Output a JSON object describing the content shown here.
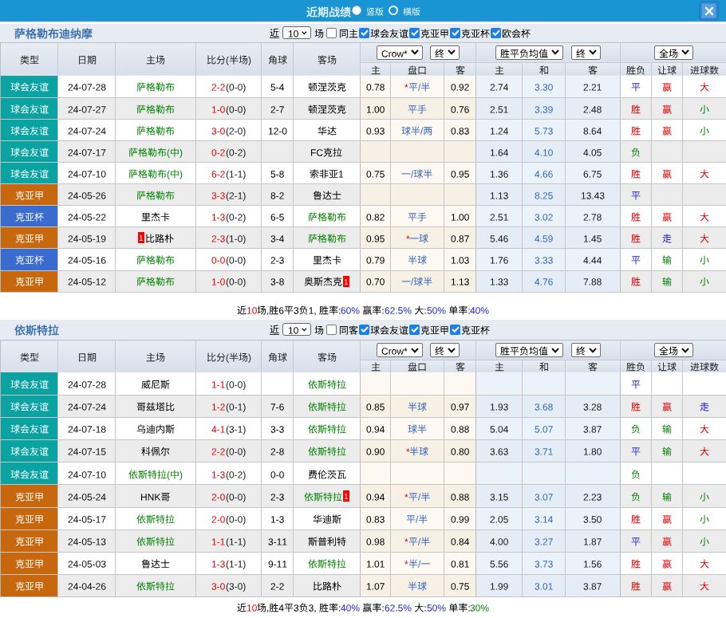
{
  "titlebar": {
    "title": "近期战绩",
    "radio_vertical_label": "竖版",
    "radio_horizontal_label": "横版",
    "radio_selected": "竖版",
    "close_icon": "x"
  },
  "icons": {
    "close": "x-mark",
    "select_chevron": "chevron-down",
    "checkbox_check": "check-mark"
  },
  "league_colors": {
    "球会友谊": "#0ba2a2",
    "克亚甲": "#c8680e",
    "克亚杯": "#3a6cd0"
  },
  "result_colors": {
    "胜": "#dd0000",
    "平": "#2222cc",
    "负": "#008000",
    "赢": "#dd0000",
    "走": "#2222cc",
    "输": "#008000",
    "大": "#dd0000",
    "小": "#008000"
  },
  "sections": [
    {
      "team": "萨格勒布迪纳摩",
      "filters": {
        "near_label": "近",
        "games_value": "10",
        "games_suffix": "场",
        "same_label": "同主",
        "same_checked": false,
        "leagues": [
          {
            "label": "球会友谊",
            "checked": true
          },
          {
            "label": "克亚甲",
            "checked": true
          },
          {
            "label": "克亚杯",
            "checked": true
          },
          {
            "label": "欧会杯",
            "checked": true
          }
        ]
      },
      "header": {
        "type": "类型",
        "date": "日期",
        "home": "主场",
        "score": "比分(半场)",
        "corner": "角球",
        "away": "客场",
        "odds_select": "Crow*",
        "odds_final_select": "终",
        "odds_home": "主",
        "handicap": "盘口",
        "odds_away": "客",
        "avg_select": "胜平负均值",
        "avg_final_select": "终",
        "avg_home": "主",
        "avg_draw": "和",
        "avg_away": "客",
        "scope_select": "全场",
        "result": "胜负",
        "handicap_result": "让球",
        "goals": "进球数"
      },
      "rows": [
        {
          "type": "球会友谊",
          "date": "24-07-28",
          "home": "萨格勒布",
          "home_hl": 1,
          "home_card": "",
          "away": "顿涅茨克",
          "away_hl": 0,
          "away_card": "",
          "ft": "2-2",
          "ht": "(0-0)",
          "corner": "5-4",
          "o1": "0.78",
          "star": "*",
          "hcap": "平/半",
          "o2": "0.92",
          "a1": "2.74",
          "a2": "3.30",
          "a3": "2.21",
          "res": "平",
          "hres": "赢",
          "goal": "大"
        },
        {
          "type": "球会友谊",
          "date": "24-07-27",
          "home": "萨格勒布",
          "home_hl": 1,
          "home_card": "",
          "away": "顿涅茨克",
          "away_hl": 0,
          "away_card": "",
          "ft": "1-0",
          "ht": "(0-0)",
          "corner": "2-7",
          "o1": "1.00",
          "star": "",
          "hcap": "平手",
          "o2": "0.76",
          "a1": "2.51",
          "a2": "3.39",
          "a3": "2.48",
          "res": "胜",
          "hres": "赢",
          "goal": "小"
        },
        {
          "type": "球会友谊",
          "date": "24-07-24",
          "home": "萨格勒布",
          "home_hl": 1,
          "home_card": "",
          "away": "华达",
          "away_hl": 0,
          "away_card": "",
          "ft": "3-0",
          "ht": "(2-0)",
          "corner": "12-0",
          "o1": "0.93",
          "star": "",
          "hcap": "球半/两",
          "o2": "0.83",
          "a1": "1.24",
          "a2": "5.73",
          "a3": "8.64",
          "res": "胜",
          "hres": "赢",
          "goal": "小"
        },
        {
          "type": "球会友谊",
          "date": "24-07-17",
          "home": "萨格勒布(中)",
          "home_hl": 1,
          "home_card": "",
          "away": "FC克拉",
          "away_hl": 0,
          "away_card": "",
          "ft": "0-2",
          "ht": "(0-2)",
          "corner": "",
          "o1": "",
          "star": "",
          "hcap": "",
          "o2": "",
          "a1": "1.64",
          "a2": "4.10",
          "a3": "4.05",
          "res": "负",
          "hres": "",
          "goal": ""
        },
        {
          "type": "球会友谊",
          "date": "24-07-10",
          "home": "萨格勒布(中)",
          "home_hl": 1,
          "home_card": "",
          "away": "索非亚1",
          "away_hl": 0,
          "away_card": "",
          "ft": "6-2",
          "ht": "(1-1)",
          "corner": "5-8",
          "o1": "0.75",
          "star": "",
          "hcap": "一/球半",
          "o2": "0.95",
          "a1": "1.36",
          "a2": "4.66",
          "a3": "6.75",
          "res": "胜",
          "hres": "赢",
          "goal": "大"
        },
        {
          "type": "克亚甲",
          "date": "24-05-26",
          "home": "萨格勒布",
          "home_hl": 1,
          "home_card": "",
          "away": "鲁达士",
          "away_hl": 0,
          "away_card": "",
          "ft": "3-3",
          "ht": "(2-1)",
          "corner": "8-2",
          "o1": "",
          "star": "",
          "hcap": "",
          "o2": "",
          "a1": "1.13",
          "a2": "8.25",
          "a3": "13.43",
          "res": "平",
          "hres": "",
          "goal": ""
        },
        {
          "type": "克亚杯",
          "date": "24-05-22",
          "home": "里杰卡",
          "home_hl": 0,
          "home_card": "",
          "away": "萨格勒布",
          "away_hl": 1,
          "away_card": "",
          "ft": "1-3",
          "ht": "(0-2)",
          "corner": "6-5",
          "o1": "0.82",
          "star": "",
          "hcap": "平手",
          "o2": "1.00",
          "a1": "2.51",
          "a2": "3.02",
          "a3": "2.78",
          "res": "胜",
          "hres": "赢",
          "goal": "大"
        },
        {
          "type": "克亚甲",
          "date": "24-05-19",
          "home": "比路朴",
          "home_hl": 0,
          "home_card": "1",
          "home_card_pos": "before",
          "away": "萨格勒布",
          "away_hl": 1,
          "away_card": "",
          "ft": "2-3",
          "ht": "(1-0)",
          "corner": "3-4",
          "o1": "0.95",
          "star": "*",
          "hcap": "一球",
          "o2": "0.87",
          "a1": "5.46",
          "a2": "4.59",
          "a3": "1.45",
          "res": "胜",
          "hres": "走",
          "goal": "大"
        },
        {
          "type": "克亚杯",
          "date": "24-05-16",
          "home": "萨格勒布",
          "home_hl": 1,
          "home_card": "",
          "away": "里杰卡",
          "away_hl": 0,
          "away_card": "",
          "ft": "0-0",
          "ht": "(0-0)",
          "corner": "2-3",
          "o1": "0.79",
          "star": "",
          "hcap": "半球",
          "o2": "1.03",
          "a1": "1.76",
          "a2": "3.33",
          "a3": "4.44",
          "res": "平",
          "hres": "输",
          "goal": "小"
        },
        {
          "type": "克亚甲",
          "date": "24-05-12",
          "home": "萨格勒布",
          "home_hl": 1,
          "home_card": "",
          "away": "奥斯杰克",
          "away_hl": 0,
          "away_card": "1",
          "away_card_pos": "after",
          "ft": "1-0",
          "ht": "(0-0)",
          "corner": "3-8",
          "o1": "0.70",
          "star": "",
          "hcap": "一/球半",
          "o2": "1.13",
          "a1": "1.33",
          "a2": "4.76",
          "a3": "7.88",
          "res": "胜",
          "hres": "输",
          "goal": "小"
        }
      ],
      "summary": {
        "t1": "近",
        "games": "10",
        "t2": "场,胜6平3负1, 胜率:",
        "v1": "60%",
        "t3": " 赢率:",
        "v2": "62.5%",
        "t4": " 大:",
        "v3": "50%",
        "t5": " 单率:",
        "v4": "40%",
        "v4_color": "#2222cc"
      }
    },
    {
      "team": "依斯特拉",
      "filters": {
        "near_label": "近",
        "games_value": "10",
        "games_suffix": "场",
        "same_label": "同客",
        "same_checked": false,
        "leagues": [
          {
            "label": "球会友谊",
            "checked": true
          },
          {
            "label": "克亚甲",
            "checked": true
          },
          {
            "label": "克亚杯",
            "checked": true
          }
        ]
      },
      "header": {
        "type": "类型",
        "date": "日期",
        "home": "主场",
        "score": "比分(半场)",
        "corner": "角球",
        "away": "客场",
        "odds_select": "Crow*",
        "odds_final_select": "终",
        "odds_home": "主",
        "handicap": "盘口",
        "odds_away": "客",
        "avg_select": "胜平负均值",
        "avg_final_select": "终",
        "avg_home": "主",
        "avg_draw": "和",
        "avg_away": "客",
        "scope_select": "全场",
        "result": "胜负",
        "handicap_result": "让球",
        "goals": "进球数"
      },
      "rows": [
        {
          "type": "球会友谊",
          "date": "24-07-28",
          "home": "威尼斯",
          "home_hl": 0,
          "home_card": "",
          "away": "依斯特拉",
          "away_hl": 1,
          "away_card": "",
          "ft": "1-1",
          "ht": "(0-0)",
          "corner": "",
          "o1": "",
          "star": "",
          "hcap": "",
          "o2": "",
          "a1": "",
          "a2": "",
          "a3": "",
          "res": "平",
          "hres": "",
          "goal": ""
        },
        {
          "type": "球会友谊",
          "date": "24-07-24",
          "home": "哥兹塔比",
          "home_hl": 0,
          "home_card": "",
          "away": "依斯特拉",
          "away_hl": 1,
          "away_card": "",
          "ft": "1-2",
          "ht": "(0-1)",
          "corner": "7-6",
          "o1": "0.85",
          "star": "",
          "hcap": "半球",
          "o2": "0.97",
          "a1": "1.93",
          "a2": "3.68",
          "a3": "3.28",
          "res": "胜",
          "hres": "赢",
          "goal": "走"
        },
        {
          "type": "球会友谊",
          "date": "24-07-18",
          "home": "乌迪内斯",
          "home_hl": 0,
          "home_card": "",
          "away": "依斯特拉",
          "away_hl": 1,
          "away_card": "",
          "ft": "4-1",
          "ht": "(3-1)",
          "corner": "3-3",
          "o1": "0.94",
          "star": "",
          "hcap": "球半",
          "o2": "0.88",
          "a1": "5.04",
          "a2": "5.07",
          "a3": "3.87",
          "res": "负",
          "hres": "输",
          "goal": "大"
        },
        {
          "type": "球会友谊",
          "date": "24-07-15",
          "home": "科佩尔",
          "home_hl": 0,
          "home_card": "",
          "away": "依斯特拉",
          "away_hl": 1,
          "away_card": "",
          "ft": "2-2",
          "ht": "(0-0)",
          "corner": "2-8",
          "o1": "0.90",
          "star": "*",
          "hcap": "半球",
          "o2": "0.80",
          "a1": "3.63",
          "a2": "3.71",
          "a3": "1.80",
          "res": "平",
          "hres": "输",
          "goal": "大"
        },
        {
          "type": "球会友谊",
          "date": "24-07-10",
          "home": "依斯特拉(中)",
          "home_hl": 1,
          "home_card": "",
          "away": "费伦茨瓦",
          "away_hl": 0,
          "away_card": "",
          "ft": "1-3",
          "ht": "(0-2)",
          "corner": "0-0",
          "o1": "",
          "star": "",
          "hcap": "",
          "o2": "",
          "a1": "",
          "a2": "",
          "a3": "",
          "res": "负",
          "hres": "",
          "goal": ""
        },
        {
          "type": "克亚甲",
          "date": "24-05-24",
          "home": "HNK哥",
          "home_hl": 0,
          "home_card": "",
          "away": "依斯特拉",
          "away_hl": 1,
          "away_card": "1",
          "away_card_pos": "after",
          "ft": "2-0",
          "ht": "(0-0)",
          "corner": "2-3",
          "o1": "0.94",
          "star": "*",
          "hcap": "平/半",
          "o2": "0.88",
          "a1": "3.15",
          "a2": "3.07",
          "a3": "2.23",
          "res": "负",
          "hres": "输",
          "goal": "小"
        },
        {
          "type": "克亚甲",
          "date": "24-05-17",
          "home": "依斯特拉",
          "home_hl": 1,
          "home_card": "",
          "away": "华迪斯",
          "away_hl": 0,
          "away_card": "",
          "ft": "2-0",
          "ht": "(0-0)",
          "corner": "1-3",
          "o1": "0.83",
          "star": "",
          "hcap": "平/半",
          "o2": "0.99",
          "a1": "2.05",
          "a2": "3.14",
          "a3": "3.50",
          "res": "胜",
          "hres": "赢",
          "goal": "小"
        },
        {
          "type": "克亚甲",
          "date": "24-05-13",
          "home": "依斯特拉",
          "home_hl": 1,
          "home_card": "",
          "away": "斯普利特",
          "away_hl": 0,
          "away_card": "",
          "ft": "1-1",
          "ht": "(1-1)",
          "corner": "3-11",
          "o1": "0.98",
          "star": "*",
          "hcap": "平/半",
          "o2": "0.84",
          "a1": "4.00",
          "a2": "3.27",
          "a3": "1.87",
          "res": "平",
          "hres": "赢",
          "goal": "小"
        },
        {
          "type": "克亚甲",
          "date": "24-05-03",
          "home": "鲁达士",
          "home_hl": 0,
          "home_card": "",
          "away": "依斯特拉",
          "away_hl": 1,
          "away_card": "",
          "ft": "1-3",
          "ht": "(1-1)",
          "corner": "9-11",
          "o1": "1.01",
          "star": "*",
          "hcap": "半/一",
          "o2": "0.81",
          "a1": "5.56",
          "a2": "3.73",
          "a3": "1.56",
          "res": "胜",
          "hres": "赢",
          "goal": "大"
        },
        {
          "type": "克亚甲",
          "date": "24-04-26",
          "home": "依斯特拉",
          "home_hl": 1,
          "home_card": "",
          "away": "比路朴",
          "away_hl": 0,
          "away_card": "",
          "ft": "3-0",
          "ht": "(3-0)",
          "corner": "2-2",
          "o1": "1.07",
          "star": "",
          "hcap": "半球",
          "o2": "0.75",
          "a1": "1.99",
          "a2": "3.01",
          "a3": "3.87",
          "res": "胜",
          "hres": "赢",
          "goal": "大"
        }
      ],
      "summary": {
        "t1": "近",
        "games": "10",
        "t2": "场,胜4平3负3, 胜率:",
        "v1": "40%",
        "t3": " 赢率:",
        "v2": "62.5%",
        "t4": " 大:",
        "v3": "50%",
        "t5": " 单率:",
        "v4": "30%",
        "v4_color": "#008000"
      }
    }
  ]
}
